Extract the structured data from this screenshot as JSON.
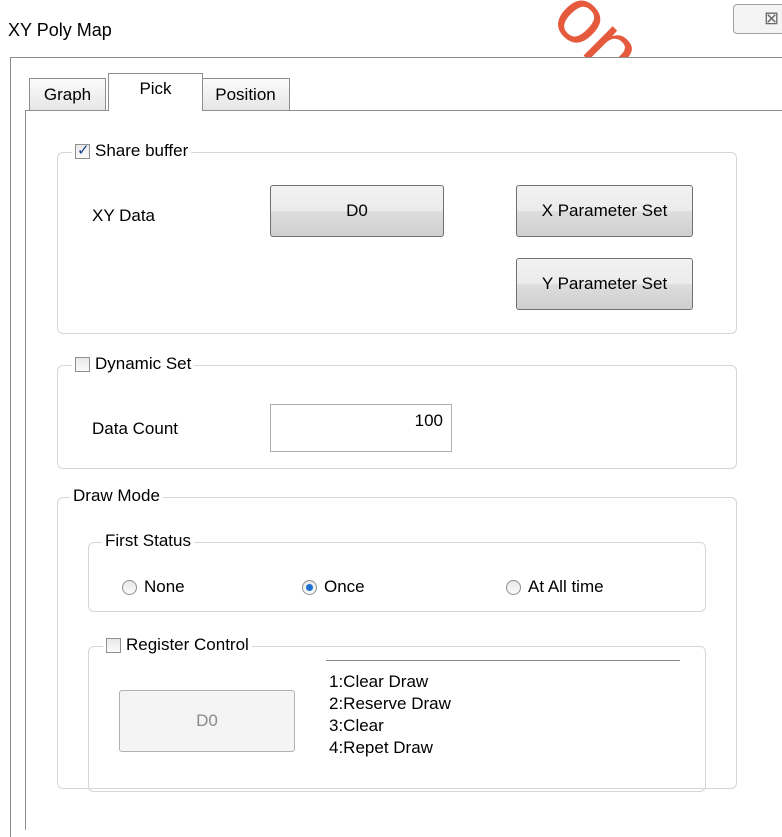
{
  "window": {
    "title": "XY Poly Map",
    "close_glyph": "⊠"
  },
  "tabs": [
    {
      "label": "Graph",
      "active": false
    },
    {
      "label": "Pick",
      "active": true
    },
    {
      "label": "Position",
      "active": false
    }
  ],
  "share_buffer": {
    "label": "Share buffer",
    "checked": true,
    "xy_data_label": "XY Data",
    "xy_data_value": "D0",
    "x_param_button": "X Parameter Set",
    "y_param_button": "Y Parameter Set"
  },
  "dynamic_set": {
    "label": "Dynamic Set",
    "checked": false,
    "data_count_label": "Data Count",
    "data_count_value": "100"
  },
  "draw_mode": {
    "label": "Draw Mode",
    "first_status": {
      "label": "First Status",
      "options": [
        "None",
        "Once",
        "At All time"
      ],
      "selected": "Once"
    },
    "register_control": {
      "label": "Register Control",
      "checked": false,
      "register_button": "D0",
      "list_items": [
        "1:Clear Draw",
        "2:Reserve Draw",
        "3:Clear",
        "4:Repet Draw"
      ]
    }
  },
  "watermark": "onghoatoa",
  "colors": {
    "watermark": "#e24828",
    "radio_selected": "#1a6fd0",
    "checkbox_check": "#1c3f8f"
  }
}
